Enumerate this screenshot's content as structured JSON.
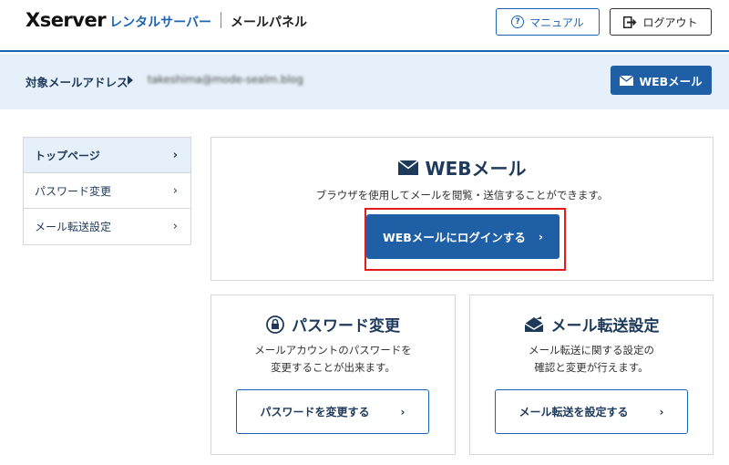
{
  "header": {
    "logo_main": "Xserver",
    "logo_sub": "レンタルサーバー",
    "panel_name": "メールパネル",
    "manual_label": "マニュアル",
    "logout_label": "ログアウト"
  },
  "address_bar": {
    "label": "対象メールアドレス",
    "value": "takeshima@mode-sealm.blog",
    "webmail_button": "WEBメール"
  },
  "sidebar": {
    "items": [
      {
        "label": "トップページ",
        "active": true
      },
      {
        "label": "パスワード変更",
        "active": false
      },
      {
        "label": "メール転送設定",
        "active": false
      }
    ]
  },
  "webmail_card": {
    "title": "WEBメール",
    "description": "ブラウザを使用してメールを閲覧・送信することができます。",
    "button_label": "WEBメールにログインする"
  },
  "password_card": {
    "title": "パスワード変更",
    "description_line1": "メールアカウントのパスワードを",
    "description_line2": "変更することが出来ます。",
    "button_label": "パスワードを変更する"
  },
  "forward_card": {
    "title": "メール転送設定",
    "description_line1": "メール転送に関する設定の",
    "description_line2": "確認と変更が行えます。",
    "button_label": "メール転送を設定する"
  },
  "colors": {
    "primary": "#1e5fa6",
    "navy_text": "#1e3a5a",
    "light_bg": "#e6f0fa",
    "highlight": "#e41b1b"
  }
}
